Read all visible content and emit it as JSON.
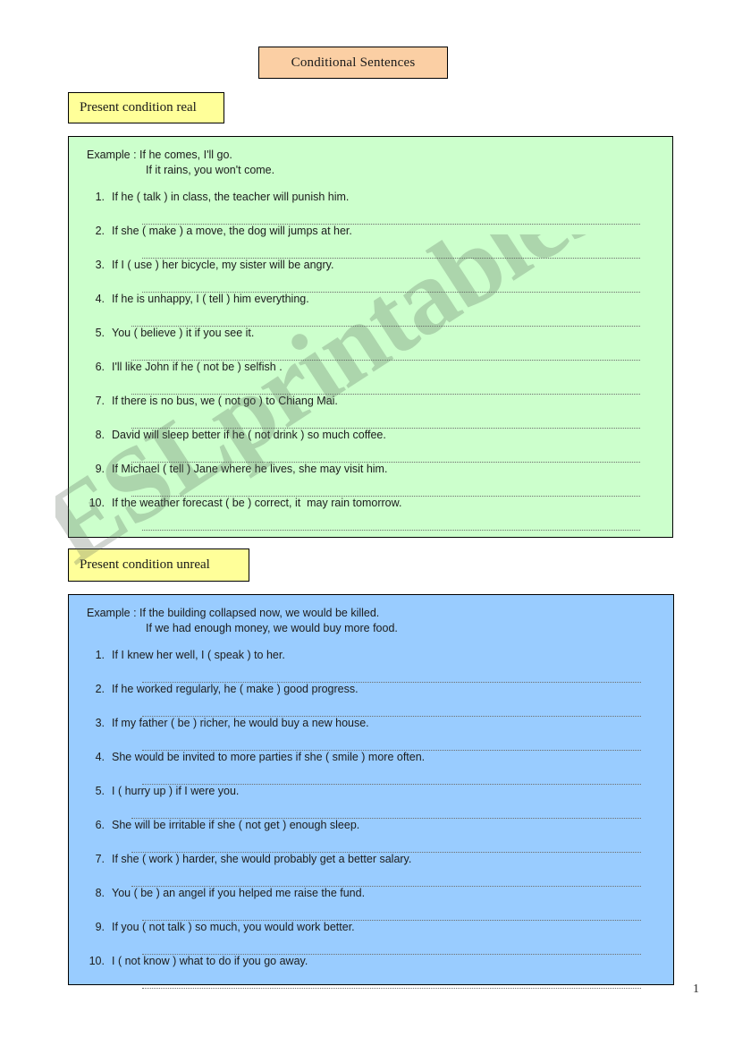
{
  "document": {
    "title": "Conditional Sentences",
    "page_number": "1",
    "watermark": "ESLprintables.com",
    "colors": {
      "title_box": "#fbcfa4",
      "chip": "#ffff99",
      "panel_real": "#ccffcc",
      "panel_unreal": "#99ccff",
      "border": "#000000",
      "text": "#1c1c1c"
    }
  },
  "sections": [
    {
      "heading": "Present condition real",
      "example_label": "Example : If he comes, I'll go.",
      "example_second": "If it rains, you won't come.",
      "items": [
        {
          "num": "1.",
          "text": "If he ( talk ) in class, the teacher will punish him."
        },
        {
          "num": "2.",
          "text": "If she ( make ) a move, the dog will jumps at her."
        },
        {
          "num": "3.",
          "text": "If I ( use ) her bicycle, my sister will be angry."
        },
        {
          "num": "4.",
          "text": "If he is unhappy, I ( tell ) him everything."
        },
        {
          "num": "5.",
          "text": "You ( believe ) it if you see it."
        },
        {
          "num": "6.",
          "text": "I'll like John if he ( not be ) selfish ."
        },
        {
          "num": "7.",
          "text": "If there is no bus, we ( not go ) to Chiang Mai."
        },
        {
          "num": "8.",
          "text": "David will sleep better if he ( not drink ) so much coffee."
        },
        {
          "num": "9.",
          "text": "If Michael ( tell ) Jane where he lives, she may visit him."
        },
        {
          "num": "10.",
          "text": "If the weather forecast ( be ) correct, it  may rain tomorrow."
        }
      ]
    },
    {
      "heading": "Present condition unreal",
      "example_label": "Example : If the building collapsed now, we would be killed.",
      "example_second": "If we had enough money, we would buy more food.",
      "items": [
        {
          "num": "1.",
          "text": "If I knew her well, I ( speak ) to her."
        },
        {
          "num": "2.",
          "text": "If he worked regularly, he ( make ) good progress."
        },
        {
          "num": "3.",
          "text": "If my father ( be ) richer, he would buy a new house."
        },
        {
          "num": "4.",
          "text": "She would be invited to more parties if she ( smile ) more often."
        },
        {
          "num": "5.",
          "text": "I ( hurry up ) if I were you."
        },
        {
          "num": "6.",
          "text": "She will be irritable if she ( not get ) enough sleep."
        },
        {
          "num": "7.",
          "text": "If she ( work ) harder, she would probably get a better salary."
        },
        {
          "num": "8.",
          "text": "You ( be ) an angel if you helped me raise the fund."
        },
        {
          "num": "9.",
          "text": "If you ( not talk ) so much, you would work better."
        },
        {
          "num": "10.",
          "text": "I ( not know ) what to do if you go away."
        }
      ]
    }
  ]
}
